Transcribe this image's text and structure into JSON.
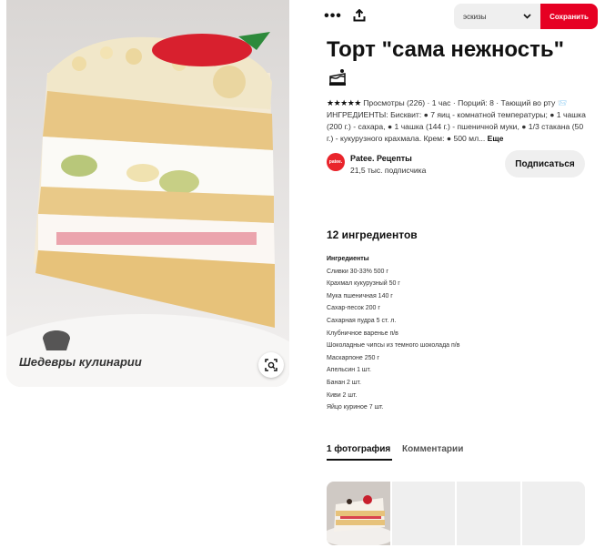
{
  "image": {
    "watermark_text": "Шедевры кулинарии"
  },
  "actions": {
    "more_icon": "more-dots-icon",
    "share_icon": "share-icon",
    "board_value": "эскизы",
    "save_label": "Сохранить"
  },
  "pin": {
    "title": "Торт \"сама нежность\"",
    "title_emoji": "cake-emoji-icon",
    "stars": "★★★★★",
    "description": " Просмотры (226) · 1 час · Порций: 8 · Тающий во рту 📨 ИНГРЕДИЕНТЫ: Бисквит: ● 7 яиц - комнатной температуры; ● 1 чашка (200 г.) - сахара, ● 1 чашка (144 г.) - пшеничной муки, ● 1/3 стакана (50 г.) - кукурузного крахмала. Крем: ● 500 мл...",
    "more_label": "Еще"
  },
  "creator": {
    "avatar_text": "patee.",
    "name": "Patee. Рецепты",
    "subscribers": "21,5 тыс. подписчика",
    "subscribe_label": "Подписаться"
  },
  "ingredients": {
    "title": "12 ингредиентов",
    "section": "Ингредиенты",
    "items": [
      "Сливки 30-33% 500 г",
      "Крахмал кукурузный 50 г",
      "Мука пшеничная 140 г",
      "Сахар-песок 200 г",
      "Сахарная пудра 5 ст. л.",
      "Клубничное варенье п/в",
      "Шоколадные чипсы из темного шоколада п/в",
      "Маскарпоне 250 г",
      "Апельсин 1 шт.",
      "Банан 2 шт.",
      "Киви 2 шт.",
      "Яйцо куриное 7 шт."
    ]
  },
  "tabs": {
    "photos_label": "1 фотография",
    "comments_label": "Комментарии"
  }
}
